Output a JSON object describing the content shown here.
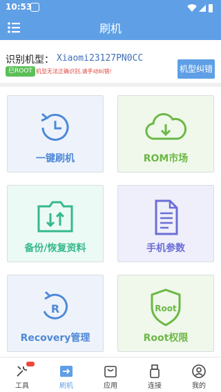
{
  "status_bar": {
    "time": "10:53"
  },
  "app_bar": {
    "title": "刷机"
  },
  "model": {
    "label": "识别机型：",
    "value": "Xiaomi23127PN0CC",
    "root_badge": "已ROOT",
    "note": "机型无法正确识别,请手动纠错!",
    "fix_button": "机型纠错"
  },
  "tiles": [
    {
      "label": "一键刷机",
      "icon": "restore-clock-icon",
      "color": "#4e89d8"
    },
    {
      "label": "ROM市场",
      "icon": "cloud-download-icon",
      "color": "#6cb745"
    },
    {
      "label": "备份/恢复资料",
      "icon": "folder-transfer-icon",
      "color": "#35b98a"
    },
    {
      "label": "手机参数",
      "icon": "document-icon",
      "color": "#6b6ed6"
    },
    {
      "label": "Recovery管理",
      "icon": "recovery-icon",
      "color": "#4e89d8"
    },
    {
      "label": "Root权限",
      "icon": "shield-icon",
      "color": "#6cb745"
    }
  ],
  "bottom_nav": [
    {
      "label": "工具",
      "icon": "tools-icon"
    },
    {
      "label": "刷机",
      "icon": "flash-icon",
      "active": true
    },
    {
      "label": "应用",
      "icon": "bag-icon"
    },
    {
      "label": "连接",
      "icon": "usb-icon"
    },
    {
      "label": "我的",
      "icon": "user-icon"
    }
  ],
  "colors": {
    "primary": "#5f9fe6",
    "danger": "#e0463c",
    "root_green": "#5bbf57"
  }
}
